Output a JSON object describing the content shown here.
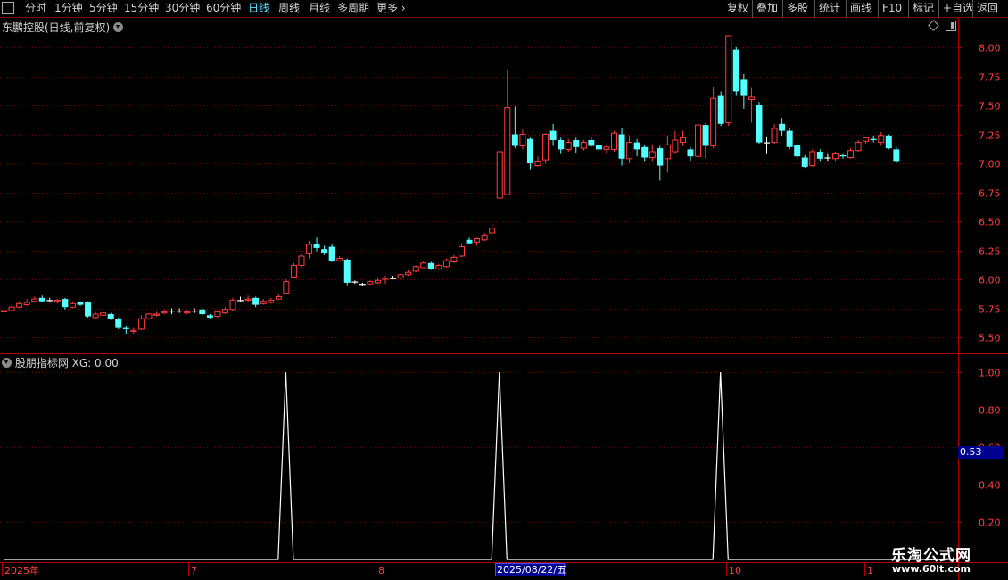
{
  "toolbar": {
    "periods": [
      "分时",
      "1分钟",
      "5分钟",
      "15分钟",
      "30分钟",
      "60分钟",
      "日线",
      "周线",
      "月线",
      "多周期",
      "更多"
    ],
    "active_period": "日线",
    "right_buttons": [
      "复权",
      "叠加",
      "多股",
      "统计",
      "画线",
      "F10",
      "标记",
      "+自选",
      "返回"
    ]
  },
  "main_chart": {
    "stock_title": "东鹏控股(日线,前复权)"
  },
  "indicator": {
    "title": "股朋指标网 XG: 0.00",
    "current_value_box": "0.53"
  },
  "watermark": {
    "brand": "乐淘公式网",
    "url": "www.60lt.com"
  },
  "x_axis": {
    "labels": [
      "2025年",
      "7",
      "8",
      "10",
      "1"
    ],
    "highlight_date": "2025/08/22/五"
  },
  "colors": {
    "up": "#ff3c3c",
    "down": "#54ffff",
    "grid": "#7a0000",
    "axis_text": "#ff4040",
    "background": "#000000"
  },
  "chart_data": [
    {
      "type": "candlestick",
      "title": "东鹏控股(日线,前复权)",
      "y_ticks": [
        5.5,
        5.75,
        6.0,
        6.25,
        6.5,
        6.75,
        7.0,
        7.25,
        7.5,
        7.75,
        8.0
      ],
      "ylim": [
        5.4,
        8.12
      ],
      "candles": [
        [
          5.72,
          5.73,
          5.75,
          5.7
        ],
        [
          5.73,
          5.76,
          5.78,
          5.72
        ],
        [
          5.76,
          5.79,
          5.81,
          5.75
        ],
        [
          5.78,
          5.8,
          5.83,
          5.77
        ],
        [
          5.81,
          5.83,
          5.85,
          5.8
        ],
        [
          5.84,
          5.81,
          5.86,
          5.8
        ],
        [
          5.82,
          5.82,
          5.84,
          5.8
        ],
        [
          5.81,
          5.82,
          5.83,
          5.79
        ],
        [
          5.83,
          5.76,
          5.84,
          5.74
        ],
        [
          5.76,
          5.79,
          5.81,
          5.75
        ],
        [
          5.8,
          5.78,
          5.81,
          5.77
        ],
        [
          5.8,
          5.68,
          5.81,
          5.67
        ],
        [
          5.67,
          5.7,
          5.72,
          5.66
        ],
        [
          5.69,
          5.71,
          5.73,
          5.68
        ],
        [
          5.7,
          5.66,
          5.71,
          5.65
        ],
        [
          5.66,
          5.58,
          5.67,
          5.57
        ],
        [
          5.58,
          5.57,
          5.6,
          5.53
        ],
        [
          5.55,
          5.56,
          5.58,
          5.53
        ],
        [
          5.57,
          5.66,
          5.69,
          5.56
        ],
        [
          5.66,
          5.7,
          5.71,
          5.65
        ],
        [
          5.69,
          5.7,
          5.72,
          5.68
        ],
        [
          5.71,
          5.72,
          5.74,
          5.7
        ],
        [
          5.73,
          5.73,
          5.75,
          5.7
        ],
        [
          5.73,
          5.73,
          5.75,
          5.71
        ],
        [
          5.71,
          5.72,
          5.74,
          5.7
        ],
        [
          5.73,
          5.73,
          5.75,
          5.71
        ],
        [
          5.74,
          5.7,
          5.75,
          5.69
        ],
        [
          5.69,
          5.67,
          5.7,
          5.66
        ],
        [
          5.68,
          5.72,
          5.73,
          5.67
        ],
        [
          5.71,
          5.74,
          5.76,
          5.7
        ],
        [
          5.74,
          5.82,
          5.84,
          5.73
        ],
        [
          5.82,
          5.82,
          5.85,
          5.8
        ],
        [
          5.82,
          5.83,
          5.86,
          5.8
        ],
        [
          5.84,
          5.78,
          5.85,
          5.76
        ],
        [
          5.79,
          5.81,
          5.83,
          5.78
        ],
        [
          5.8,
          5.82,
          5.84,
          5.79
        ],
        [
          5.83,
          5.85,
          5.87,
          5.82
        ],
        [
          5.88,
          5.98,
          6.0,
          5.87
        ],
        [
          6.02,
          6.12,
          6.14,
          6.01
        ],
        [
          6.12,
          6.2,
          6.22,
          6.1
        ],
        [
          6.22,
          6.3,
          6.33,
          6.18
        ],
        [
          6.3,
          6.27,
          6.36,
          6.24
        ],
        [
          6.26,
          6.23,
          6.29,
          6.21
        ],
        [
          6.28,
          6.16,
          6.3,
          6.15
        ],
        [
          6.16,
          6.18,
          6.2,
          6.16
        ],
        [
          6.17,
          5.97,
          6.18,
          5.95
        ],
        [
          5.98,
          5.98,
          5.99,
          5.96
        ],
        [
          5.96,
          5.96,
          5.97,
          5.94
        ],
        [
          5.96,
          5.98,
          5.99,
          5.96
        ],
        [
          5.97,
          5.99,
          6.01,
          5.96
        ],
        [
          6.0,
          6.01,
          6.03,
          5.96
        ],
        [
          6.01,
          6.01,
          6.03,
          6.0
        ],
        [
          6.01,
          6.04,
          6.05,
          6.0
        ],
        [
          6.04,
          6.06,
          6.08,
          6.03
        ],
        [
          6.07,
          6.11,
          6.12,
          6.06
        ],
        [
          6.1,
          6.14,
          6.16,
          6.1
        ],
        [
          6.14,
          6.09,
          6.15,
          6.08
        ],
        [
          6.09,
          6.12,
          6.13,
          6.08
        ],
        [
          6.11,
          6.16,
          6.18,
          6.1
        ],
        [
          6.15,
          6.19,
          6.21,
          6.14
        ],
        [
          6.2,
          6.28,
          6.31,
          6.19
        ],
        [
          6.34,
          6.31,
          6.36,
          6.3
        ],
        [
          6.32,
          6.35,
          6.36,
          6.29
        ],
        [
          6.34,
          6.38,
          6.4,
          6.33
        ],
        [
          6.4,
          6.44,
          6.48,
          6.39
        ],
        [
          6.7,
          7.1,
          7.1,
          6.7
        ],
        [
          6.73,
          7.48,
          7.8,
          6.73
        ],
        [
          7.25,
          7.15,
          7.49,
          7.13
        ],
        [
          7.15,
          7.25,
          7.29,
          7.12
        ],
        [
          7.21,
          7.0,
          7.22,
          6.95
        ],
        [
          6.98,
          7.02,
          7.06,
          6.97
        ],
        [
          7.03,
          7.25,
          7.26,
          7.0
        ],
        [
          7.28,
          7.2,
          7.34,
          7.15
        ],
        [
          7.2,
          7.12,
          7.22,
          7.08
        ],
        [
          7.12,
          7.18,
          7.21,
          7.1
        ],
        [
          7.2,
          7.14,
          7.22,
          7.09
        ],
        [
          7.13,
          7.18,
          7.2,
          7.11
        ],
        [
          7.2,
          7.15,
          7.22,
          7.14
        ],
        [
          7.16,
          7.12,
          7.18,
          7.1
        ],
        [
          7.12,
          7.14,
          7.16,
          7.08
        ],
        [
          7.12,
          7.26,
          7.28,
          7.1
        ],
        [
          7.25,
          7.04,
          7.3,
          6.98
        ],
        [
          7.04,
          7.18,
          7.24,
          7.0
        ],
        [
          7.18,
          7.12,
          7.21,
          7.06
        ],
        [
          7.14,
          7.05,
          7.16,
          7.02
        ],
        [
          7.05,
          7.1,
          7.16,
          7.02
        ],
        [
          7.13,
          6.98,
          7.15,
          6.85
        ],
        [
          7.04,
          7.16,
          7.24,
          6.92
        ],
        [
          7.1,
          7.2,
          7.28,
          7.08
        ],
        [
          7.18,
          7.22,
          7.28,
          7.15
        ],
        [
          7.12,
          7.06,
          7.14,
          7.02
        ],
        [
          7.06,
          7.33,
          7.36,
          7.04
        ],
        [
          7.33,
          7.15,
          7.35,
          7.04
        ],
        [
          7.15,
          7.56,
          7.66,
          7.13
        ],
        [
          7.58,
          7.34,
          7.62,
          7.32
        ],
        [
          7.35,
          8.1,
          8.1,
          7.32
        ],
        [
          7.98,
          7.62,
          8.0,
          7.58
        ],
        [
          7.72,
          7.58,
          7.77,
          7.47
        ],
        [
          7.55,
          7.57,
          7.65,
          7.35
        ],
        [
          7.5,
          7.18,
          7.53,
          7.17
        ],
        [
          7.18,
          7.18,
          7.23,
          7.08
        ],
        [
          7.18,
          7.3,
          7.34,
          7.17
        ],
        [
          7.34,
          7.28,
          7.39,
          7.24
        ],
        [
          7.28,
          7.14,
          7.3,
          7.12
        ],
        [
          7.16,
          7.06,
          7.18,
          7.04
        ],
        [
          7.05,
          6.97,
          7.07,
          6.96
        ],
        [
          6.98,
          7.1,
          7.12,
          6.97
        ],
        [
          7.1,
          7.04,
          7.12,
          7.02
        ],
        [
          7.05,
          7.05,
          7.08,
          7.02
        ],
        [
          7.04,
          7.08,
          7.1,
          7.02
        ],
        [
          7.07,
          7.06,
          7.08,
          7.04
        ],
        [
          7.05,
          7.11,
          7.13,
          7.04
        ],
        [
          7.11,
          7.18,
          7.2,
          7.1
        ],
        [
          7.19,
          7.22,
          7.23,
          7.17
        ],
        [
          7.21,
          7.2,
          7.24,
          7.18
        ],
        [
          7.18,
          7.24,
          7.27,
          7.15
        ],
        [
          7.24,
          7.13,
          7.25,
          7.12
        ],
        [
          7.12,
          7.02,
          7.14,
          7.0
        ]
      ]
    },
    {
      "type": "line",
      "title": "股朋指标网 XG: 0.00",
      "y_ticks": [
        0.2,
        0.4,
        0.6,
        0.8,
        1.0
      ],
      "ylim": [
        -0.11,
        1.07
      ],
      "values_note_points": "XG value per bar",
      "x": [
        0,
        35,
        36,
        37,
        38,
        63,
        64,
        65,
        66,
        92,
        93,
        94,
        95,
        121
      ],
      "y": [
        0,
        0,
        0,
        1,
        0,
        0,
        0,
        1,
        0,
        0,
        0,
        1,
        0,
        0
      ]
    }
  ]
}
